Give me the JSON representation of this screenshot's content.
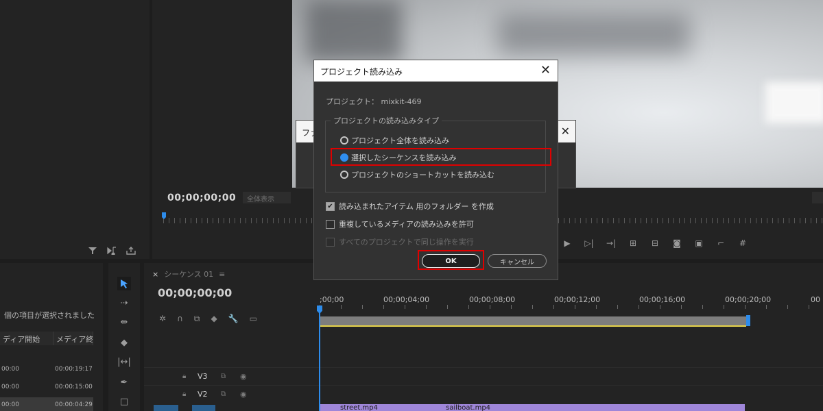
{
  "dialog": {
    "title": "プロジェクト読み込み",
    "close_glyph": "✕",
    "project_line": "プロジェクト： mixkit-469",
    "group_label": "プロジェクトの読み込みタイプ",
    "options": [
      {
        "label": "プロジェクト全体を読み込み",
        "selected": false
      },
      {
        "label": "選択したシーケンスを読み込み",
        "selected": true
      },
      {
        "label": "プロジェクトのショートカットを読み込む",
        "selected": false
      }
    ],
    "checkboxes": [
      {
        "label": "読み込まれたアイテム 用のフォルダー を作成",
        "checked": true,
        "disabled": false
      },
      {
        "label": "重複しているメディアの読み込みを許可",
        "checked": false,
        "disabled": false
      },
      {
        "label": "すべてのプロジェクトで同じ操作を実行",
        "checked": false,
        "disabled": true
      }
    ],
    "ok_label": "OK",
    "cancel_label": "キャンセル",
    "accent_color": "#2f8ef0",
    "highlight_color": "#e00000"
  },
  "bg_dialog": {
    "title_fragment": "ファ",
    "close_glyph": "✕"
  },
  "source_monitor": {
    "timecode": "00;00;00;00",
    "fit_label": "全体表示"
  },
  "project_list": {
    "selected_text": "個の項目が選択されました",
    "columns": [
      "ディア開始",
      "メディア終"
    ],
    "rows": [
      {
        "start": "00:00",
        "end": "00:00:19:17"
      },
      {
        "start": "00:00",
        "end": "00:00:15:00"
      },
      {
        "start": "00:00",
        "end": "00:00:04:29"
      }
    ]
  },
  "timeline": {
    "sequence_name": "シーケンス 01",
    "timecode": "00;00;00;00",
    "ruler_labels": [
      ";00;00",
      "00;00;04;00",
      "00;00;08;00",
      "00;00;12;00",
      "00;00;16;00",
      "00;00;20;00",
      "00"
    ],
    "tracks": [
      {
        "name": "V3"
      },
      {
        "name": "V2"
      }
    ],
    "clips": [
      {
        "name": "street.mp4"
      },
      {
        "name": "sailboat.mp4"
      }
    ]
  }
}
